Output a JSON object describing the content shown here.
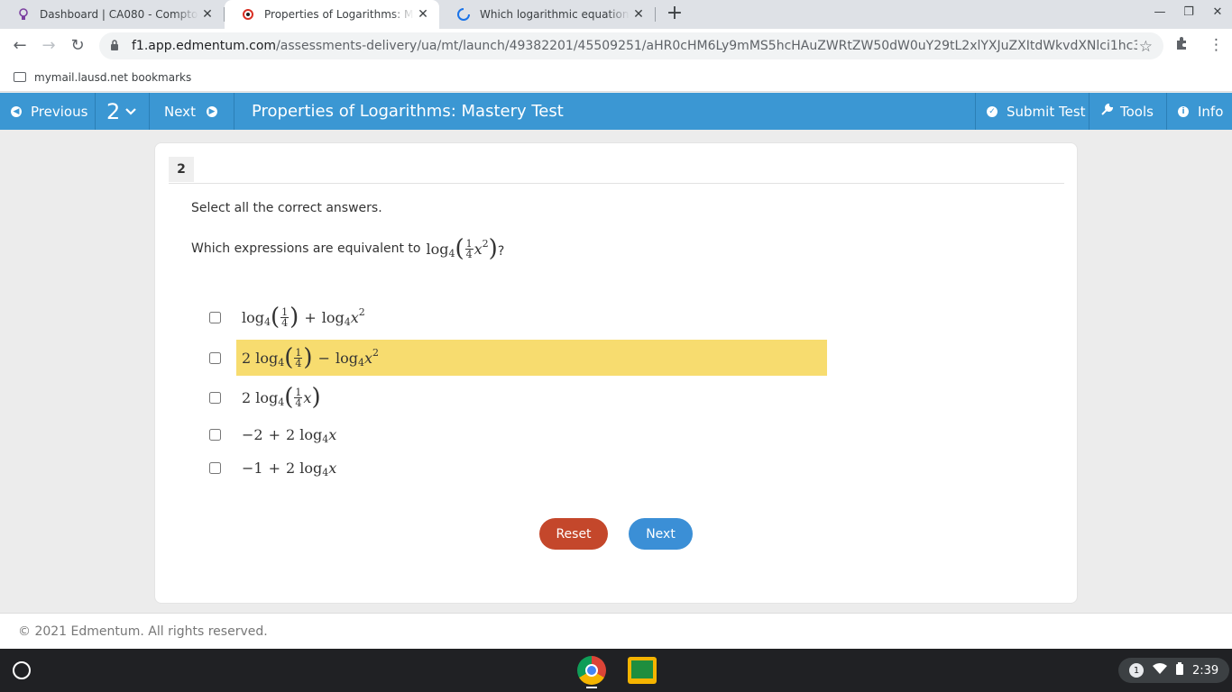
{
  "browser": {
    "tabs": [
      {
        "title": "Dashboard | CA080 - Compton F",
        "close": "✕"
      },
      {
        "title": "Properties of Logarithms: Maste",
        "close": "✕"
      },
      {
        "title": "Which logarithmic equation is e",
        "close": "✕"
      }
    ],
    "new_tab": "+",
    "window_controls": {
      "minimize": "—",
      "restore": "❐",
      "close": "✕"
    },
    "nav": {
      "back": "←",
      "forward": "→",
      "reload": "↻"
    },
    "url_domain": "f1.app.edmentum.com",
    "url_path": "/assessments-delivery/ua/mt/launch/49382201/45509251/aHR0cHM6Ly9mMS5hcHAuZWRtZW50dW0uY29tL2xlYXJuZXItdWkvdXNlci1hc3NpZ25tZW50cy8…",
    "bookmarks": [
      {
        "label": "mymail.lausd.net bookmarks"
      }
    ]
  },
  "app": {
    "previous_label": "Previous",
    "question_number": "2",
    "next_label": "Next",
    "title": "Properties of Logarithms: Mastery Test",
    "submit_label": "Submit Test",
    "tools_label": "Tools",
    "info_label": "Info"
  },
  "question": {
    "number": "2",
    "instructions": "Select all the correct answers.",
    "prompt_text": "Which expressions are equivalent to",
    "prompt_end": "?",
    "options": [
      {
        "id": "a",
        "checked": false,
        "highlighted": false
      },
      {
        "id": "b",
        "checked": false,
        "highlighted": true
      },
      {
        "id": "c",
        "checked": false,
        "highlighted": false
      },
      {
        "id": "d",
        "checked": false,
        "highlighted": false
      },
      {
        "id": "e",
        "checked": false,
        "highlighted": false
      }
    ],
    "reset_label": "Reset",
    "next_label": "Next"
  },
  "footer": {
    "copyright": "© 2021 Edmentum. All rights reserved."
  },
  "shelf": {
    "notification_count": "1",
    "time": "2:39"
  },
  "colors": {
    "header": "#3b97d3",
    "highlight": "#f7dc6f",
    "reset": "#c4472b",
    "next": "#3b8fd6"
  }
}
